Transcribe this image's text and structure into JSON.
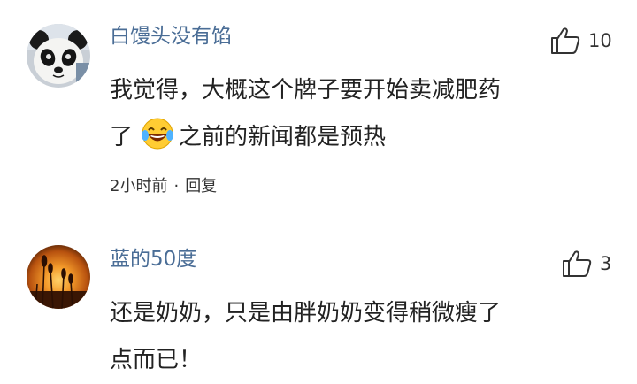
{
  "comments": [
    {
      "username": "白馒头没有馅",
      "likes": "10",
      "lines": [
        "我觉得，大概这个牌子要开始卖减肥药",
        "了",
        "之前的新闻都是预热"
      ],
      "time": "2小时前",
      "separator": "·",
      "reply": "回复",
      "avatar_icon": "panda-plush-avatar",
      "emoji_icon": "laughing-with-tears-emoji"
    },
    {
      "username": "蓝的50度",
      "likes": "3",
      "lines": [
        "还是奶奶，只是由胖奶奶变得稍微瘦了",
        "点而已！"
      ],
      "avatar_icon": "sunset-reeds-avatar"
    }
  ],
  "colors": {
    "username": "#4a6d96",
    "text": "#222222",
    "meta": "#333333"
  }
}
